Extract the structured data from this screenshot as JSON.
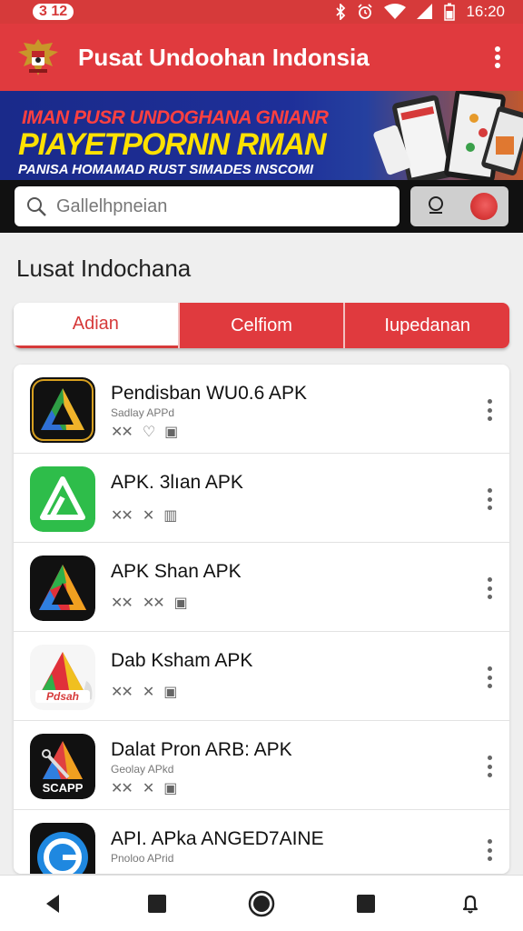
{
  "status_bar": {
    "notification_badge": "3 12",
    "time": "16:20",
    "icons": [
      "bluetooth-icon",
      "alarm-icon",
      "wifi-icon",
      "signal-icon",
      "battery-icon"
    ]
  },
  "app_bar": {
    "title": "Pusat Undoohan Indonsia",
    "logo_icon": "garuda-emblem-icon",
    "menu_icon": "more-vertical-icon"
  },
  "banner": {
    "line1": "IMAN PUSR UNDOGHANA GNIANR",
    "line2": "PIAYETPORNN RMAN",
    "line3": "PANISA HOMAMAD RUST SIMADES INSCOMI"
  },
  "search": {
    "placeholder": "Gallelhpneian"
  },
  "section": {
    "title": "Lusat Indochana"
  },
  "tabs": [
    {
      "label": "Adian",
      "active": true
    },
    {
      "label": "Celfiom",
      "active": false
    },
    {
      "label": "Iupedanan",
      "active": false
    }
  ],
  "apps": [
    {
      "name": "Pendisban WU0.6 APK",
      "subtitle": "Sadlay APPd",
      "meta": [
        "✕✕",
        "♡",
        "▣"
      ],
      "icon": "triangle-dark-icon"
    },
    {
      "name": "APK. 3lıan APK",
      "subtitle": "",
      "meta": [
        "✕✕",
        "✕",
        "▥"
      ],
      "icon": "triangle-green-icon"
    },
    {
      "name": "APK Shan APK",
      "subtitle": "",
      "meta": [
        "✕✕",
        "✕✕",
        "▣"
      ],
      "icon": "triangle-rainbow-icon"
    },
    {
      "name": "Dab Ksham APK",
      "subtitle": "",
      "meta": [
        "✕✕",
        "✕",
        "▣"
      ],
      "icon": "triangle-sticker-icon"
    },
    {
      "name": "Dalat Pron ARB: APK",
      "subtitle": "Geolay APkd",
      "meta": [
        "✕✕",
        "✕",
        "▣"
      ],
      "icon": "triangle-scapp-icon"
    },
    {
      "name": "API. APka ANGED7AINE",
      "subtitle": "Pnoloo APrid",
      "meta": [],
      "icon": "globe-blue-icon"
    }
  ],
  "sticker_text": "Pdsah",
  "scapp_text": "SCAPP",
  "nav_bar": [
    "back-icon",
    "stop-icon",
    "home-icon",
    "recent-icon",
    "bell-icon"
  ],
  "colors": {
    "primary": "#e03a3e",
    "statusbar": "#d63a3a",
    "banner_yellow": "#ffe100",
    "banner_red": "#ff4040"
  }
}
